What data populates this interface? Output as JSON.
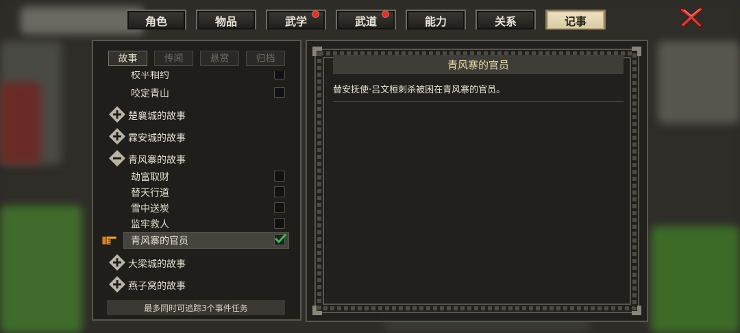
{
  "tabs": [
    {
      "label": "角色",
      "badge": false,
      "active": false
    },
    {
      "label": "物品",
      "badge": false,
      "active": false
    },
    {
      "label": "武学",
      "badge": true,
      "active": false
    },
    {
      "label": "武道",
      "badge": true,
      "active": false
    },
    {
      "label": "能力",
      "badge": false,
      "active": false
    },
    {
      "label": "关系",
      "badge": false,
      "active": false
    },
    {
      "label": "记事",
      "badge": false,
      "active": true
    }
  ],
  "subtabs": [
    {
      "label": "故事",
      "active": true
    },
    {
      "label": "传闻",
      "active": false
    },
    {
      "label": "悬赏",
      "active": false
    },
    {
      "label": "归档",
      "active": false
    }
  ],
  "list": {
    "partial_item": "校平相约",
    "items": [
      {
        "kind": "item",
        "label": "咬定青山",
        "checked": false
      },
      {
        "kind": "group",
        "label": "楚襄城的故事",
        "expanded": false
      },
      {
        "kind": "group",
        "label": "霖安城的故事",
        "expanded": false
      },
      {
        "kind": "group",
        "label": "青风寨的故事",
        "expanded": true
      },
      {
        "kind": "item",
        "label": "劫富取财",
        "checked": false
      },
      {
        "kind": "item",
        "label": "替天行道",
        "checked": false
      },
      {
        "kind": "item",
        "label": "雪中送炭",
        "checked": false
      },
      {
        "kind": "item",
        "label": "监牢救人",
        "checked": false
      },
      {
        "kind": "item",
        "label": "青风寨的官员",
        "checked": true,
        "selected": true
      },
      {
        "kind": "group",
        "label": "大梁城的故事",
        "expanded": false
      },
      {
        "kind": "group",
        "label": "燕子窝的故事",
        "expanded": false
      }
    ]
  },
  "footer": "最多同时可追踪3个事件任务",
  "detail": {
    "title": "青风寨的官员",
    "description": "替安抚使·吕文桓刺杀被困在青风寨的官员。"
  },
  "colors": {
    "accent_gold": "#ecd9a6",
    "badge_red": "#d9342b",
    "check_green": "#3fbf4a"
  }
}
